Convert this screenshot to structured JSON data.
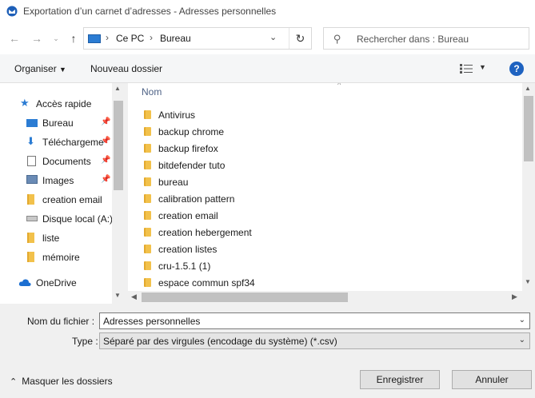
{
  "window": {
    "title": "Exportation d’un carnet d’adresses - Adresses personnelles"
  },
  "address_bar": {
    "crumbs": [
      "Ce PC",
      "Bureau"
    ]
  },
  "search": {
    "placeholder": "Rechercher dans : Bureau"
  },
  "toolbar": {
    "organize_label": "Organiser",
    "new_folder_label": "Nouveau dossier",
    "help_label": "?"
  },
  "nav_pane": {
    "items": [
      {
        "label": "Accès rapide",
        "icon": "star-icon",
        "pinned": false
      },
      {
        "label": "Bureau",
        "icon": "desktop-icon",
        "pinned": true
      },
      {
        "label": "Téléchargeme",
        "icon": "download-icon",
        "pinned": true
      },
      {
        "label": "Documents",
        "icon": "documents-icon",
        "pinned": true
      },
      {
        "label": "Images",
        "icon": "images-icon",
        "pinned": true
      },
      {
        "label": "creation email",
        "icon": "folder-icon",
        "pinned": false
      },
      {
        "label": "Disque local (A:)",
        "icon": "drive-icon",
        "pinned": false
      },
      {
        "label": "liste",
        "icon": "folder-icon",
        "pinned": false
      },
      {
        "label": "mémoire",
        "icon": "folder-icon",
        "pinned": false
      },
      {
        "label": "OneDrive",
        "icon": "cloud-icon",
        "pinned": false
      }
    ]
  },
  "file_list": {
    "column_header": "Nom",
    "items": [
      "Antivirus",
      "backup chrome",
      "backup firefox",
      "bitdefender tuto",
      "bureau",
      "calibration pattern",
      "creation email",
      "creation hebergement",
      "creation listes",
      "cru-1.5.1 (1)",
      "espace commun spf34"
    ]
  },
  "form": {
    "filename_label": "Nom du fichier :",
    "filename_value": "Adresses personnelles",
    "type_label": "Type :",
    "type_value": "Séparé par des virgules (encodage du système) (*.csv)"
  },
  "footer": {
    "hide_folders_label": "Masquer les dossiers",
    "save_label": "Enregistrer",
    "cancel_label": "Annuler"
  },
  "colors": {
    "accent": "#1e62c0",
    "folder": "#f2c14b"
  }
}
